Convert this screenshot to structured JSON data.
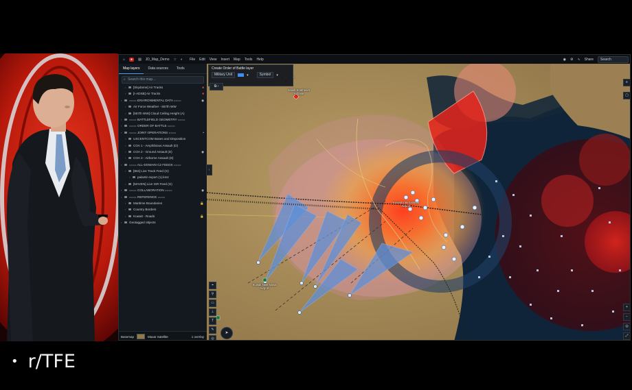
{
  "topbar": {
    "rec_label": "●",
    "doc_name": "JD_Map_Demo",
    "menus": [
      "File",
      "Edit",
      "View",
      "Insert",
      "Map",
      "Tools",
      "Help"
    ],
    "share_label": "Share",
    "search_placeholder": "Search"
  },
  "sidebar": {
    "tabs": [
      "Map layers",
      "Data sources",
      "Tools"
    ],
    "search_placeholder": "Search this map...",
    "layers": [
      {
        "label": "[Skydome] Air Tracks",
        "indent": 1,
        "kind": "track",
        "action": "red"
      },
      {
        "label": "[I-ADSB] Air Tracks",
        "indent": 1,
        "kind": "track",
        "action": "red"
      },
      {
        "label": "==== ENVIRONMENTAL DATA ====",
        "indent": 0,
        "kind": "group",
        "action": "eye"
      },
      {
        "label": "Air Force Weather - 557th WW",
        "indent": 1,
        "kind": "folder"
      },
      {
        "label": "[557th WW] Cloud Ceiling Height (A)",
        "indent": 1,
        "kind": "folder"
      },
      {
        "label": "==== BATTLEFIELD GEOMETRY ====",
        "indent": 0,
        "kind": "group"
      },
      {
        "label": "==== ORDER OF BATTLE ====",
        "indent": 0,
        "kind": "group"
      },
      {
        "label": "==== JOINT OPERATIONS ====",
        "indent": 0,
        "kind": "group",
        "action": "dot"
      },
      {
        "label": "USCENTCOM Bases and Disposition",
        "indent": 1,
        "kind": "folder"
      },
      {
        "label": "COA 1 - Amphibious Assault (D)",
        "indent": 1,
        "kind": "folder"
      },
      {
        "label": "COA 2 - Ground Assault (D)",
        "indent": 1,
        "kind": "folder",
        "action": "eye"
      },
      {
        "label": "COA 3 - Airborne Assault (D)",
        "indent": 1,
        "kind": "folder"
      },
      {
        "label": "==== ALL-DOMAIN C2 FEEDS ====",
        "indent": 0,
        "kind": "group"
      },
      {
        "label": "[IBS] Live Track Feed (G)",
        "indent": 1,
        "kind": "folder"
      },
      {
        "label": "palantir export (1).kmz",
        "indent": 2,
        "kind": "file"
      },
      {
        "label": "[MAVEN] Live ISR Feed (G)",
        "indent": 1,
        "kind": "folder"
      },
      {
        "label": "==== COLLABORATION ====",
        "indent": 0,
        "kind": "group",
        "action": "eye"
      },
      {
        "label": "==== REFERENCE ====",
        "indent": 0,
        "kind": "group"
      },
      {
        "label": "Maritime Boundaries",
        "indent": 1,
        "kind": "folder",
        "action": "lock"
      },
      {
        "label": "Country Borders",
        "indent": 1,
        "kind": "folder"
      },
      {
        "label": "Kuwait - Roads",
        "indent": 1,
        "kind": "folder",
        "action": "lock"
      },
      {
        "label": "Geotagged objects",
        "indent": 0,
        "kind": "folder"
      }
    ],
    "basemap_label": "Basemap",
    "basemap_name": "Maxar Satellite",
    "overlay_label": "1 overlay"
  },
  "map": {
    "ob_panel": {
      "title": "Create Order of Battle layer",
      "unit_label": "Military Unit",
      "symbol_label": "Symbol"
    },
    "labels": [
      {
        "text": "Jualah Highway Site",
        "id": "lbl-jualah"
      },
      {
        "text": "Jaliah Southeast Airbase",
        "id": "lbl-jaliah"
      },
      {
        "text": "Kuwait Nwe Naval Airport",
        "id": "lbl-naval"
      },
      {
        "text": "Kuwait International Airport",
        "id": "lbl-kia"
      }
    ],
    "colors": {
      "land": "#a4895a",
      "sea": "#0f2438",
      "threat_red": "#e5251c",
      "pink": "#e8a0b4",
      "blue_sector": "#5f8fd8"
    }
  },
  "caption": {
    "bullet": "•",
    "text": "r/TFE"
  }
}
